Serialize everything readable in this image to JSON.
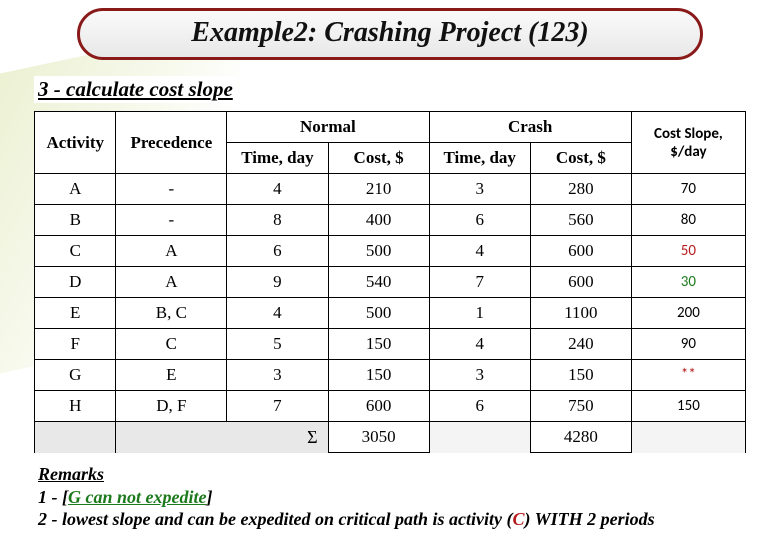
{
  "title": "Example2: Crashing Project (123)",
  "subtitle": "3 - calculate cost slope",
  "chart_data": {
    "type": "table",
    "columns": [
      "Activity",
      "Precedence",
      "Normal Time, day",
      "Normal Cost, $",
      "Crash Time, day",
      "Crash Cost, $",
      "Cost Slope, $/day"
    ],
    "rows": [
      [
        "A",
        "-",
        4,
        210,
        3,
        280,
        "70"
      ],
      [
        "B",
        "-",
        8,
        400,
        6,
        560,
        "80"
      ],
      [
        "C",
        "A",
        6,
        500,
        4,
        600,
        "50"
      ],
      [
        "D",
        "A",
        9,
        540,
        7,
        600,
        "30"
      ],
      [
        "E",
        "B, C",
        4,
        500,
        1,
        1100,
        "200"
      ],
      [
        "F",
        "C",
        5,
        150,
        4,
        240,
        "90"
      ],
      [
        "G",
        "E",
        3,
        150,
        3,
        150,
        "**"
      ],
      [
        "H",
        "D, F",
        7,
        600,
        6,
        750,
        "150"
      ]
    ],
    "sum_normal_cost": 3050,
    "sum_crash_cost": 4280
  },
  "headers": {
    "activity": "Activity",
    "precedence": "Precedence",
    "normal": "Normal",
    "crash": "Crash",
    "time": "Time, day",
    "cost": "Cost, $",
    "cost_slope_l1": "Cost Slope,",
    "cost_slope_l2": "$/day"
  },
  "rows": {
    "0": {
      "act": "A",
      "prec": "-",
      "nt": "4",
      "nc": "210",
      "ct": "3",
      "cc": "280",
      "slope": "70"
    },
    "1": {
      "act": "B",
      "prec": "-",
      "nt": "8",
      "nc": "400",
      "ct": "6",
      "cc": "560",
      "slope": "80"
    },
    "2": {
      "act": "C",
      "prec": "A",
      "nt": "6",
      "nc": "500",
      "ct": "4",
      "cc": "600",
      "slope": "50"
    },
    "3": {
      "act": "D",
      "prec": "A",
      "nt": "9",
      "nc": "540",
      "ct": "7",
      "cc": "600",
      "slope": "30"
    },
    "4": {
      "act": "E",
      "prec": "B, C",
      "nt": "4",
      "nc": "500",
      "ct": "1",
      "cc": "1100",
      "slope": "200"
    },
    "5": {
      "act": "F",
      "prec": "C",
      "nt": "5",
      "nc": "150",
      "ct": "4",
      "cc": "240",
      "slope": "90"
    },
    "6": {
      "act": "G",
      "prec": "E",
      "nt": "3",
      "nc": "150",
      "ct": "3",
      "cc": "150",
      "slope": "**"
    },
    "7": {
      "act": "H",
      "prec": "D, F",
      "nt": "7",
      "nc": "600",
      "ct": "6",
      "cc": "750",
      "slope": "150"
    }
  },
  "sum": {
    "sigma": "Σ",
    "nc": "3050",
    "cc": "4280"
  },
  "remarks": {
    "hd": "Remarks",
    "l1a": "1 - [",
    "l1b": "G can not expedite",
    "l1c": "]",
    "l2a": "2 - lowest slope and can be expedited on critical path is activity (",
    "l2b": "C",
    "l2c": ") WITH 2 periods"
  }
}
